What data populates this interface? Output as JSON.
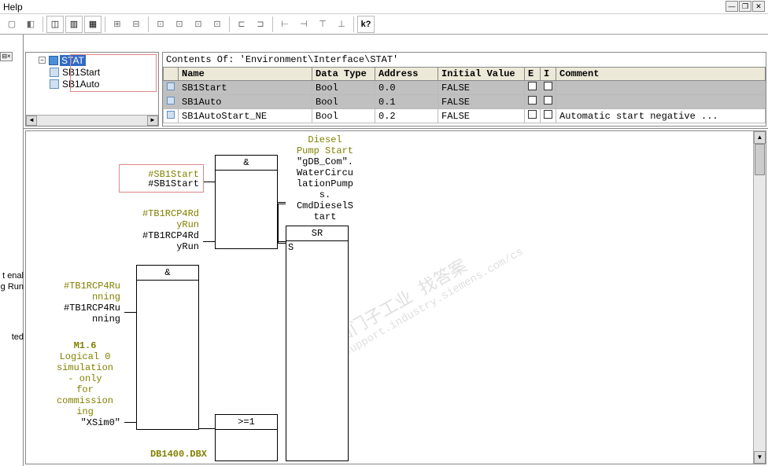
{
  "menu": {
    "help": "Help"
  },
  "sidebar_truncated": {
    "line1": "t enal",
    "line2": "g Run",
    "line3": "ted"
  },
  "tree": {
    "root": "STAT",
    "items": [
      "SB1Start",
      "SB1Auto"
    ]
  },
  "contents_label": "Contents Of: 'Environment\\Interface\\STAT'",
  "table": {
    "headers": {
      "name": "Name",
      "datatype": "Data Type",
      "address": "Address",
      "initial": "Initial Value",
      "e": "E",
      "i": "I",
      "comment": "Comment"
    },
    "rows": [
      {
        "name": "SB1Start",
        "datatype": "Bool",
        "address": "0.0",
        "initial": "FALSE",
        "comment": "",
        "selected": true
      },
      {
        "name": "SB1Auto",
        "datatype": "Bool",
        "address": "0.1",
        "initial": "FALSE",
        "comment": "",
        "selected": true
      },
      {
        "name": "SB1AutoStart_NE",
        "datatype": "Bool",
        "address": "0.2",
        "initial": "FALSE",
        "comment": "Automatic start negative ...",
        "selected": false
      }
    ]
  },
  "diagram": {
    "and1": "&",
    "and2": "&",
    "or1": ">=1",
    "sr_title": "SR",
    "sr_s": "S",
    "sb1start_sym": "#SB1Start",
    "sb1start_var": "#SB1Start",
    "tb1rcp_ready_sym": "#TB1RCP4Rd\nyRun",
    "tb1rcp_ready_var": "#TB1RCP4Rd\nyRun",
    "tb1rcp_run_sym": "#TB1RCP4Ru\nnning",
    "tb1rcp_run_var": "#TB1RCP4Ru\nnning",
    "m16_title": "M1.6",
    "m16_desc": "Logical 0\nsimulation\n- only\nfor\ncommission\ning",
    "xsim0": "\"XSim0\"",
    "db1400": "DB1400.DBX",
    "diesel_title": "Diesel\nPump Start",
    "diesel_body": "\"gDB_Com\".\nWaterCircu\nlationPump\ns.\nCmdDieselS\ntart"
  },
  "watermark": {
    "l1": "西门子工业  找答案",
    "l2": "support.industry.siemens.com/cs"
  }
}
